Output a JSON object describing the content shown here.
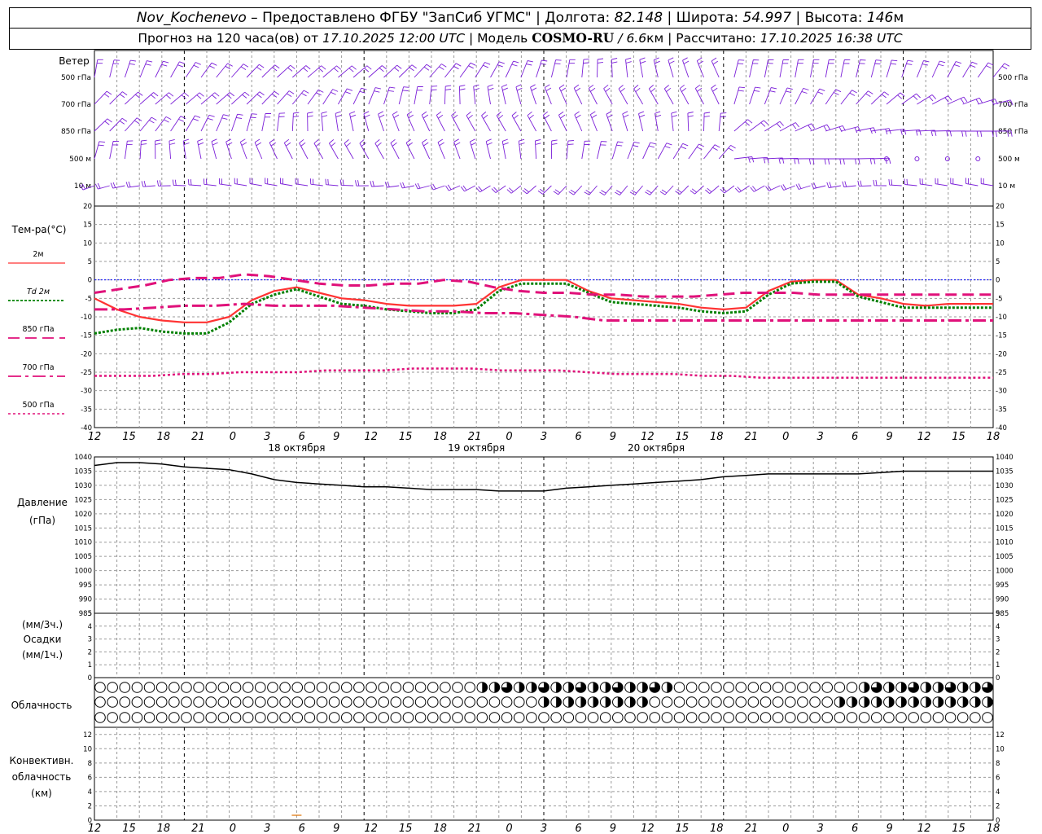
{
  "header": {
    "station": "Nov_Kochenevo",
    "dash": "–",
    "provided": "Предоставлено ФГБУ \"ЗапСиб УГМС\"",
    "sep": "|",
    "lon_label": "Долгота:",
    "lon_value": "82.148",
    "lat_label": "Широта:",
    "lat_value": "54.997",
    "alt_label": "Высота:",
    "alt_value": "146",
    "alt_unit": "м",
    "forecast_label": "Прогноз на 120 часа(ов) от",
    "forecast_from": "17.10.2025 12:00 UTC",
    "model_label": "Модель",
    "model_name": "COSMO-RU",
    "slash": "/",
    "model_res": "6.6",
    "model_res_unit": "км",
    "computed_label": "Рассчитано:",
    "computed_value": "17.10.2025 16:38 UTC"
  },
  "colors": {
    "wind": "#7b1fd8",
    "t2m": "#ff3333",
    "td2m": "#008000",
    "t850": "#e0117a",
    "t700": "#e0117a",
    "t500": "#e0117a",
    "pressure": "#000000",
    "zero_line": "#0000ff",
    "grid": "#999999",
    "precip_marker": "#e07000"
  },
  "time_axis": {
    "hour_labels": [
      "12",
      "15",
      "18",
      "21",
      "0",
      "3",
      "6",
      "9",
      "12",
      "15",
      "18",
      "21",
      "0",
      "3",
      "6",
      "9",
      "12",
      "15",
      "18",
      "21",
      "0",
      "3",
      "6",
      "9",
      "12",
      "15",
      "18"
    ],
    "date_labels": [
      "18 октября",
      "19 октября",
      "20 октября"
    ]
  },
  "wind_panel": {
    "title": "Ветер",
    "levels": [
      "500 гПа",
      "700 гПа",
      "850 гПа",
      "500 м",
      "10 м"
    ]
  },
  "temp_panel": {
    "title": "Тем-ра(°C)",
    "legend": [
      {
        "label": "2м",
        "style": "solid"
      },
      {
        "label": "Td",
        "label2": "2м",
        "style": "dotted"
      },
      {
        "label": "850 гПа",
        "style": "dashed"
      },
      {
        "label": "700 гПа",
        "style": "dashdot"
      },
      {
        "label": "500 гПа",
        "style": "dotted"
      }
    ]
  },
  "pressure_panel": {
    "title": "Давление",
    "unit": "(гПа)"
  },
  "precip_panel": {
    "unit_top": "(мм/3ч.)",
    "title": "Осадки",
    "unit_bottom": "(мм/1ч.)"
  },
  "cloud_panel": {
    "title": "Облачность"
  },
  "conv_panel": {
    "title1": "Конвективн.",
    "title2": "облачность",
    "unit": "(км)"
  },
  "chart_data": [
    {
      "type": "line",
      "name": "temperature",
      "x_hours": [
        0,
        3,
        6,
        9,
        12,
        15,
        18,
        21,
        24,
        27,
        30,
        33,
        36,
        39,
        42,
        45,
        48,
        51,
        54,
        57,
        60,
        63,
        66,
        69,
        72,
        75,
        78,
        81,
        84,
        87,
        90,
        93,
        96,
        99,
        102,
        105,
        108,
        111,
        114,
        117,
        120
      ],
      "ylim": [
        -40,
        20
      ],
      "yticks": [
        20,
        15,
        10,
        5,
        0,
        -5,
        -10,
        -15,
        -20,
        -25,
        -30,
        -35,
        -40
      ],
      "series": [
        {
          "name": "2м",
          "values": [
            -5,
            -8,
            -10,
            -11,
            -11.5,
            -11.5,
            -10,
            -5.5,
            -3,
            -2,
            -3.5,
            -5,
            -5.5,
            -6.5,
            -7,
            -7,
            -7,
            -6.5,
            -2,
            0,
            0,
            0,
            -3,
            -5,
            -5.5,
            -6,
            -6.5,
            -7.5,
            -8,
            -7.5,
            -3,
            -0.5,
            0,
            0,
            -4,
            -5,
            -6.5,
            -7,
            -6.5,
            -6.5,
            -6.5
          ]
        },
        {
          "name": "Td 2м",
          "values": [
            -14.5,
            -13.5,
            -13,
            -14,
            -14.5,
            -14.5,
            -11.5,
            -6.5,
            -4,
            -2.5,
            -4.5,
            -6.5,
            -7,
            -8,
            -8.5,
            -9,
            -9,
            -8,
            -3,
            -1,
            -1,
            -1,
            -3.5,
            -6,
            -6.5,
            -7,
            -7.5,
            -8.5,
            -9,
            -8.5,
            -4,
            -1,
            -0.5,
            -0.5,
            -4.5,
            -6,
            -7.5,
            -7.5,
            -7.5,
            -7.5,
            -7.5
          ]
        },
        {
          "name": "850 гПа",
          "values": [
            -3.5,
            -2.5,
            -1.5,
            0,
            0.5,
            0.5,
            1.5,
            1,
            0,
            -1,
            -1.5,
            -1.5,
            -1,
            -1,
            0,
            -0.5,
            -2,
            -3,
            -3.5,
            -3.5,
            -4,
            -4,
            -4.5,
            -4.5,
            -4.5,
            -4,
            -3.5,
            -3.5,
            -3.5,
            -4,
            -4,
            -4,
            -4,
            -4,
            -4,
            -4,
            -4
          ]
        },
        {
          "name": "700 гПа",
          "values": [
            -8,
            -8,
            -7.5,
            -7,
            -7,
            -6.5,
            -7,
            -7,
            -7,
            -7.5,
            -8,
            -8.5,
            -8.5,
            -9,
            -9,
            -9.5,
            -10,
            -11,
            -11,
            -11,
            -11,
            -11,
            -11,
            -11,
            -11,
            -11,
            -11,
            -11,
            -11,
            -11,
            -11
          ]
        },
        {
          "name": "500 гПа",
          "values": [
            -26,
            -26,
            -26,
            -25.5,
            -25.5,
            -25,
            -25,
            -25,
            -24.5,
            -24.5,
            -24.5,
            -24,
            -24,
            -24,
            -24.5,
            -24.5,
            -24.5,
            -25,
            -25.5,
            -25.5,
            -25.5,
            -26,
            -26,
            -26.5,
            -26.5,
            -26.5,
            -26.5,
            -26.5,
            -26.5,
            -26.5,
            -26.5,
            -26.5
          ]
        }
      ]
    },
    {
      "type": "line",
      "name": "pressure",
      "ylim": [
        985,
        1040
      ],
      "yticks": [
        1040,
        1035,
        1030,
        1025,
        1020,
        1015,
        1010,
        1005,
        1000,
        995,
        990,
        985
      ],
      "x_hours": [
        0,
        3,
        6,
        9,
        12,
        15,
        18,
        21,
        24,
        27,
        30,
        33,
        36,
        39,
        42,
        45,
        48,
        51,
        54,
        57,
        60,
        63,
        66,
        69,
        72,
        75,
        78,
        81,
        84,
        87,
        90,
        93,
        96,
        99,
        102,
        105,
        108,
        111,
        114,
        117,
        120
      ],
      "values": [
        1037,
        1038,
        1038,
        1037.5,
        1036.5,
        1036,
        1035.5,
        1034,
        1032,
        1031,
        1030.5,
        1030,
        1029.5,
        1029.5,
        1029,
        1028.5,
        1028.5,
        1028.5,
        1028,
        1028,
        1028,
        1029,
        1029.5,
        1030,
        1030.5,
        1031,
        1031.5,
        1032,
        1033,
        1033.5,
        1034,
        1034,
        1034,
        1034,
        1034,
        1034.5,
        1035,
        1035,
        1035,
        1035,
        1035
      ]
    },
    {
      "type": "bar",
      "name": "precipitation",
      "ylim": [
        0,
        5
      ],
      "yticks": [
        5,
        4,
        3,
        2,
        1,
        0
      ],
      "values": []
    },
    {
      "type": "bar",
      "name": "convective_cloudiness",
      "ylim": [
        0,
        13
      ],
      "yticks": [
        12,
        10,
        8,
        6,
        4,
        2,
        0
      ],
      "values": []
    }
  ]
}
